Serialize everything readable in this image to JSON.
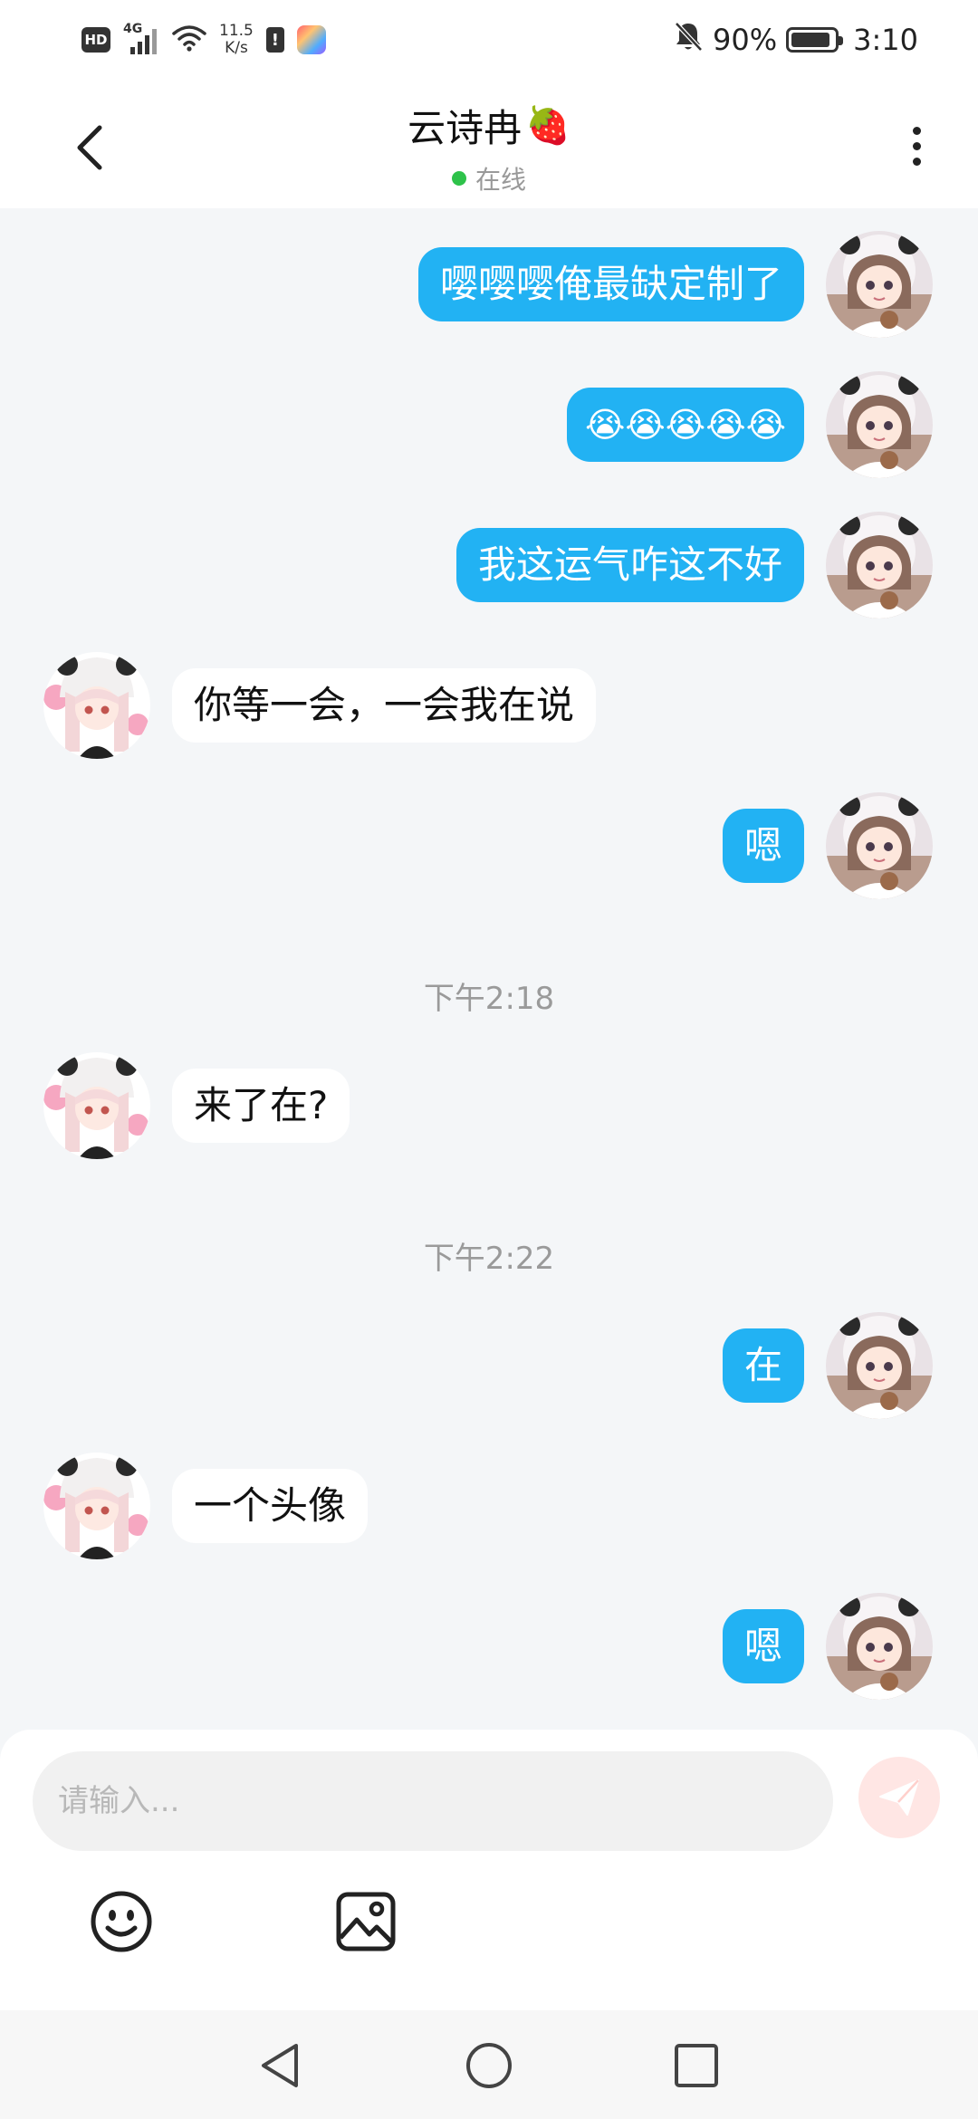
{
  "status_bar": {
    "hd": "HD",
    "network": "4G",
    "speed_value": "11.5",
    "speed_unit": "K/s",
    "battery_percent": "90%",
    "battery_level": 0.9,
    "time": "3:10"
  },
  "header": {
    "title": "云诗冉",
    "title_emoji": "🍓",
    "status": "在线",
    "status_color": "#2ec24a"
  },
  "messages": [
    {
      "from": "me",
      "text": "嘤嘤嘤俺最缺定制了"
    },
    {
      "from": "me",
      "text": "😭😭😭😭😭"
    },
    {
      "from": "me",
      "text": "我这运气咋这不好"
    },
    {
      "from": "them",
      "text": "你等一会，一会我在说"
    },
    {
      "from": "me",
      "text": "嗯"
    },
    {
      "time": "下午2:18"
    },
    {
      "from": "them",
      "text": "来了在?"
    },
    {
      "time": "下午2:22"
    },
    {
      "from": "me",
      "text": "在"
    },
    {
      "from": "them",
      "text": "一个头像"
    },
    {
      "from": "me",
      "text": "嗯"
    }
  ],
  "input": {
    "placeholder": "请输入..."
  },
  "icons": {
    "back": "back-arrow-icon",
    "more": "more-vertical-icon",
    "send": "send-icon",
    "emoji": "emoji-icon",
    "image": "image-icon",
    "nav_back": "nav-back-icon",
    "nav_home": "nav-home-icon",
    "nav_recent": "nav-recent-icon"
  },
  "colors": {
    "my_bubble": "#22b2f3",
    "their_bubble": "#ffffff",
    "chat_background": "#f4f6f8",
    "send_button": "#ffe6e4"
  }
}
